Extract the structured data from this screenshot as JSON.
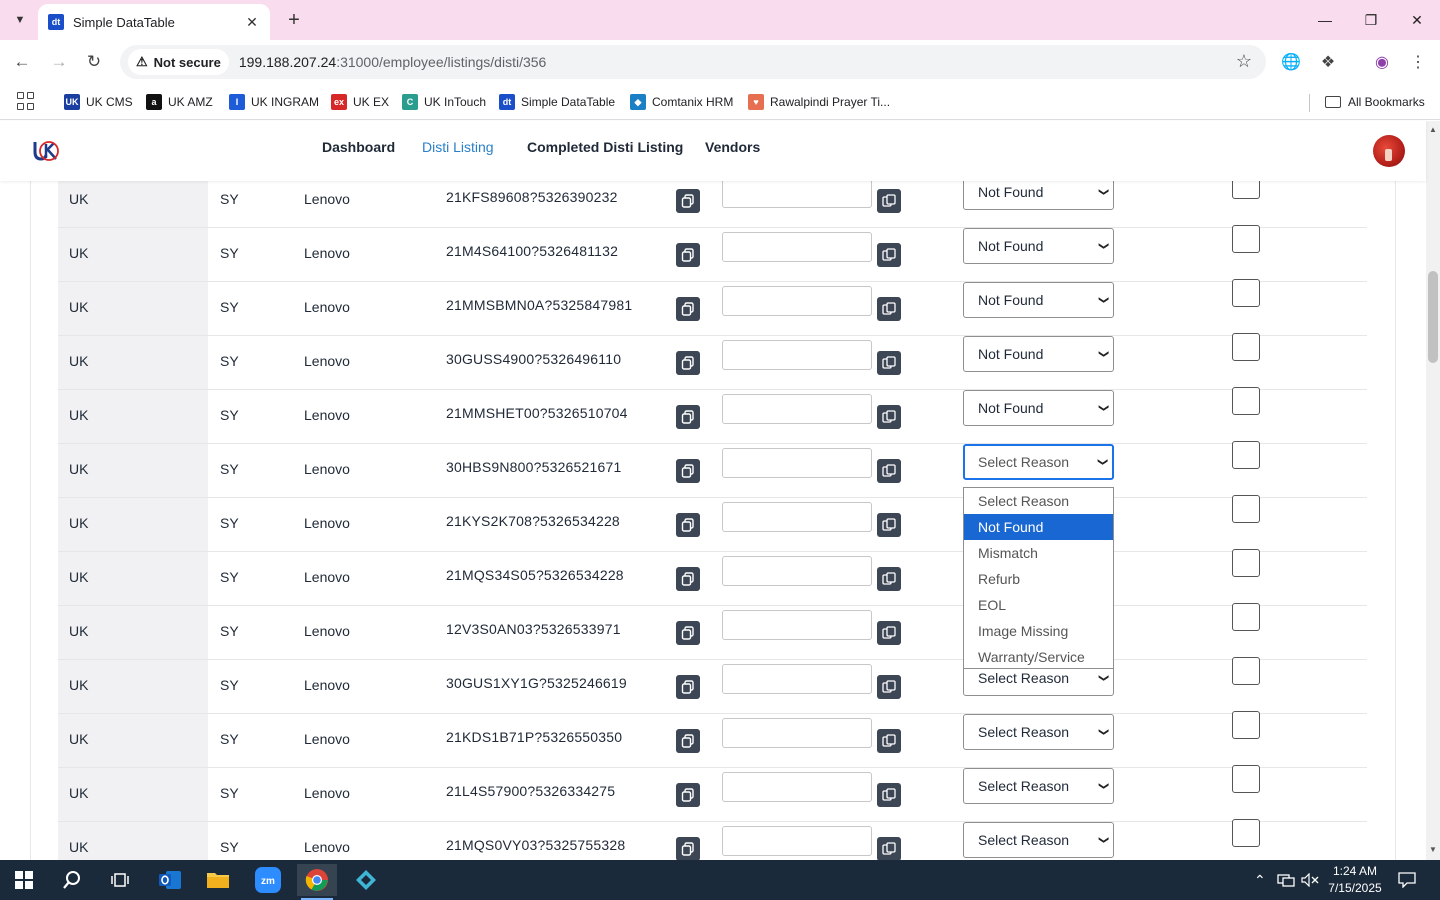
{
  "browser": {
    "tab_title": "Simple DataTable",
    "tab_favicon_text": "dt",
    "security_label": "Not secure",
    "url_host": "199.188.207.24",
    "url_path": ":31000/employee/listings/disti/356",
    "bookmarks": [
      {
        "label": "UK CMS",
        "color": "#1a3fa0",
        "icon": "UK"
      },
      {
        "label": "UK AMZ",
        "color": "#111111",
        "icon": "a"
      },
      {
        "label": "UK INGRAM",
        "color": "#1e5bd8",
        "icon": "I"
      },
      {
        "label": "UK EX",
        "color": "#d62828",
        "icon": "ex"
      },
      {
        "label": "UK InTouch",
        "color": "#2a9d8f",
        "icon": "C"
      },
      {
        "label": "Simple DataTable",
        "color": "#1a4fc9",
        "icon": "dt"
      },
      {
        "label": "Comtanix HRM",
        "color": "#1a7fc4",
        "icon": "◆"
      },
      {
        "label": "Rawalpindi Prayer Ti...",
        "color": "#e76f51",
        "icon": "♥"
      }
    ],
    "all_bookmarks_label": "All Bookmarks"
  },
  "header": {
    "logo_text": "UK",
    "nav": [
      {
        "label": "Dashboard",
        "active": false
      },
      {
        "label": "Disti Listing",
        "active": true
      },
      {
        "label": "Completed Disti Listing",
        "active": false
      },
      {
        "label": "Vendors",
        "active": false
      }
    ]
  },
  "table": {
    "rows": [
      {
        "country": "UK",
        "code": "SY",
        "brand": "Lenovo",
        "sku": "21KFS89608?5326390232",
        "reason": "Not Found"
      },
      {
        "country": "UK",
        "code": "SY",
        "brand": "Lenovo",
        "sku": "21M4S64100?5326481132",
        "reason": "Not Found"
      },
      {
        "country": "UK",
        "code": "SY",
        "brand": "Lenovo",
        "sku": "21MMSBMN0A?5325847981",
        "reason": "Not Found"
      },
      {
        "country": "UK",
        "code": "SY",
        "brand": "Lenovo",
        "sku": "30GUSS4900?5326496110",
        "reason": "Not Found"
      },
      {
        "country": "UK",
        "code": "SY",
        "brand": "Lenovo",
        "sku": "21MMSHET00?5326510704",
        "reason": "Not Found"
      },
      {
        "country": "UK",
        "code": "SY",
        "brand": "Lenovo",
        "sku": "30HBS9N800?5326521671",
        "reason": "Select Reason"
      },
      {
        "country": "UK",
        "code": "SY",
        "brand": "Lenovo",
        "sku": "21KYS2K708?5326534228",
        "reason": "Select Reason"
      },
      {
        "country": "UK",
        "code": "SY",
        "brand": "Lenovo",
        "sku": "21MQS34S05?5326534228",
        "reason": "Select Reason"
      },
      {
        "country": "UK",
        "code": "SY",
        "brand": "Lenovo",
        "sku": "12V3S0AN03?5326533971",
        "reason": "Select Reason"
      },
      {
        "country": "UK",
        "code": "SY",
        "brand": "Lenovo",
        "sku": "30GUS1XY1G?5325246619",
        "reason": "Select Reason"
      },
      {
        "country": "UK",
        "code": "SY",
        "brand": "Lenovo",
        "sku": "21KDS1B71P?5326550350",
        "reason": "Select Reason"
      },
      {
        "country": "UK",
        "code": "SY",
        "brand": "Lenovo",
        "sku": "21L4S57900?5326334275",
        "reason": "Select Reason"
      },
      {
        "country": "UK",
        "code": "SY",
        "brand": "Lenovo",
        "sku": "21MQS0VY03?5325755328",
        "reason": "Select Reason"
      }
    ],
    "open_dropdown_row": 5,
    "reason_options": [
      "Select Reason",
      "Not Found",
      "Mismatch",
      "Refurb",
      "EOL",
      "Image Missing",
      "Warranty/Service"
    ],
    "highlighted_option": "Not Found"
  },
  "taskbar": {
    "time": "1:24 AM",
    "date": "7/15/2025"
  }
}
